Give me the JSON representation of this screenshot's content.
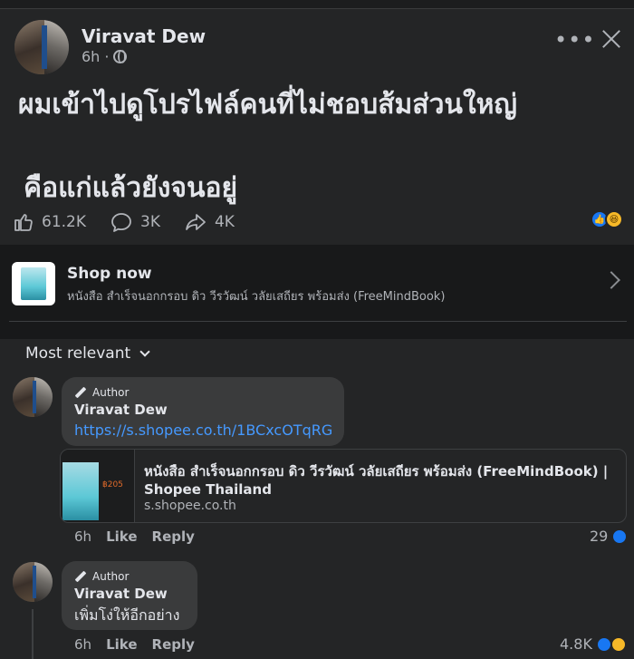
{
  "post": {
    "author": "Viravat Dew",
    "time": "6h",
    "text_line1": "ผมเข้าไปดูโปรไฟล์คนที่ไม่ชอบส้มส่วนใหญ่",
    "text_line2": "คือแก่แล้วยังจนอยู่",
    "likes": "61.2K",
    "comments": "3K",
    "shares": "4K",
    "icons": [
      "globe-icon",
      "more-icon",
      "close-icon",
      "like-icon",
      "comment-icon",
      "share-icon"
    ]
  },
  "shop": {
    "title": "Shop now",
    "description": "หนังสือ สำเร็จนอกกรอบ ดิว วีรวัฒน์ วลัยเสถียร พร้อมส่ง (FreeMindBook)"
  },
  "sort": {
    "label": "Most relevant"
  },
  "comments": [
    {
      "badge": "Author",
      "name": "Viravat Dew",
      "link": "https://s.shopee.co.th/1BCxcOTqRG",
      "card_title": "หนังสือ สำเร็จนอกกรอบ ดิว วีรวัฒน์ วลัยเสถียร พร้อมส่ง (FreeMindBook) | Shopee Thailand",
      "card_domain": "s.shopee.co.th",
      "time": "6h",
      "like_label": "Like",
      "reply_label": "Reply",
      "reaction_count": "29"
    },
    {
      "badge": "Author",
      "name": "Viravat Dew",
      "text": "เพิ่มโง่ให้อีกอย่าง",
      "time": "6h",
      "like_label": "Like",
      "reply_label": "Reply",
      "reaction_count": "4.8K"
    }
  ],
  "colors": {
    "background": "#242526",
    "link": "#4599ff",
    "like": "#1877f2",
    "haha": "#f7b928"
  }
}
